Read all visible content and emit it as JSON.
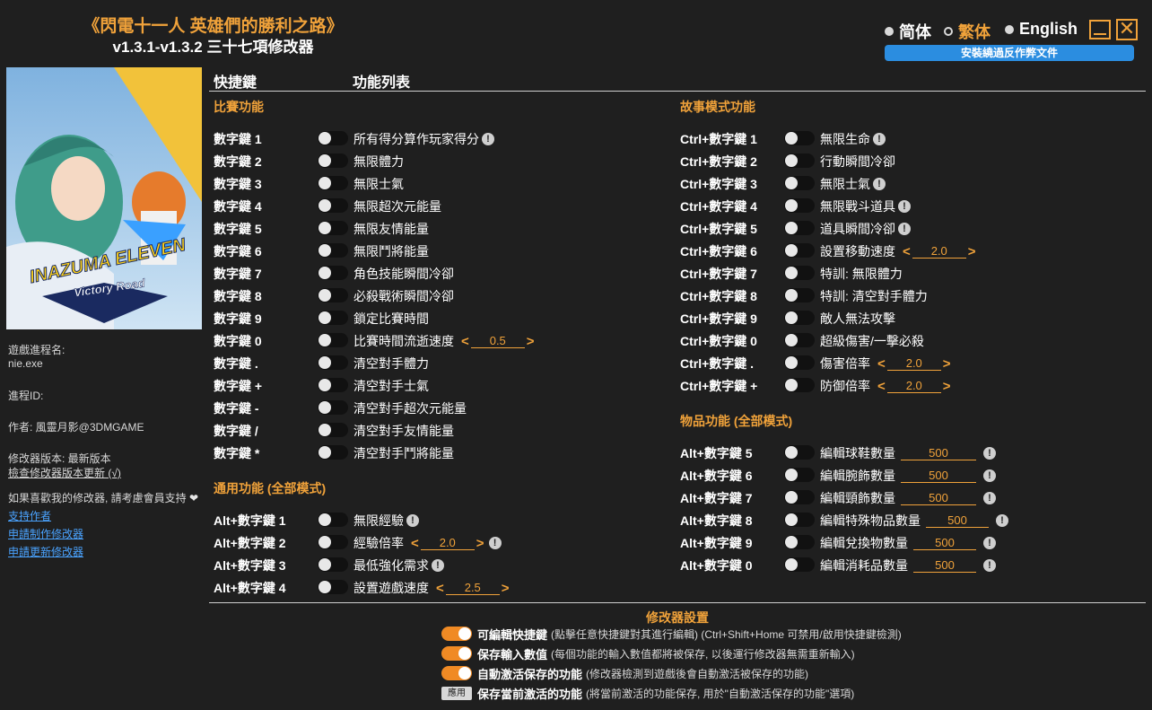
{
  "app": {
    "title_line1": "《閃電十一人 英雄們的勝利之路》",
    "title_line2": "v1.3.1-v1.3.2 三十七項修改器"
  },
  "languages": [
    {
      "label": "简体",
      "active": false
    },
    {
      "label": "繁体",
      "active": true
    },
    {
      "label": "English",
      "active": false
    }
  ],
  "window": {
    "close_glyph": "✕"
  },
  "install_button": "安裝繞過反作弊文件",
  "cover": {
    "logo_text": "INAZUMA ELEVEN",
    "logo_sub": "Victory Road"
  },
  "info": {
    "process_name_label": "遊戲進程名:",
    "process_name": "nie.exe",
    "process_id_label": "進程ID:",
    "author": "作者: 風靈月影@3DMGAME",
    "version": "修改器版本: 最新版本",
    "check_update": "檢查修改器版本更新 (√)",
    "support_text": "如果喜歡我的修改器, 請考慮會員支持",
    "links": [
      "支持作者",
      "申請制作修改器",
      "申請更新修改器"
    ]
  },
  "header": {
    "hotkey": "快捷鍵",
    "list": "功能列表"
  },
  "sections": {
    "match": "比賽功能",
    "general": "通用功能 (全部模式)",
    "story": "故事模式功能",
    "items": "物品功能 (全部模式)"
  },
  "match_rows": [
    {
      "key": "數字鍵 1",
      "name": "所有得分算作玩家得分",
      "warn": true
    },
    {
      "key": "數字鍵 2",
      "name": "無限體力"
    },
    {
      "key": "數字鍵 3",
      "name": "無限士氣"
    },
    {
      "key": "數字鍵 4",
      "name": "無限超次元能量"
    },
    {
      "key": "數字鍵 5",
      "name": "無限友情能量"
    },
    {
      "key": "數字鍵 6",
      "name": "無限鬥將能量"
    },
    {
      "key": "數字鍵 7",
      "name": "角色技能瞬間冷卻"
    },
    {
      "key": "數字鍵 8",
      "name": "必殺戰術瞬間冷卻"
    },
    {
      "key": "數字鍵 9",
      "name": "鎖定比賽時間"
    },
    {
      "key": "數字鍵 0",
      "name": "比賽時間流逝速度",
      "value": "0.5"
    },
    {
      "key": "數字鍵 .",
      "name": "清空對手體力"
    },
    {
      "key": "數字鍵 +",
      "name": "清空對手士氣"
    },
    {
      "key": "數字鍵 -",
      "name": "清空對手超次元能量"
    },
    {
      "key": "數字鍵 /",
      "name": "清空對手友情能量"
    },
    {
      "key": "數字鍵 *",
      "name": "清空對手鬥將能量"
    }
  ],
  "general_rows": [
    {
      "key": "Alt+數字鍵 1",
      "name": "無限經驗",
      "warn": true
    },
    {
      "key": "Alt+數字鍵 2",
      "name": "經驗倍率",
      "value": "2.0",
      "warn": true
    },
    {
      "key": "Alt+數字鍵 3",
      "name": "最低強化需求",
      "warn": true
    },
    {
      "key": "Alt+數字鍵 4",
      "name": "設置遊戲速度",
      "value": "2.5"
    }
  ],
  "story_rows": [
    {
      "key": "Ctrl+數字鍵 1",
      "name": "無限生命",
      "warn": true
    },
    {
      "key": "Ctrl+數字鍵 2",
      "name": "行動瞬間冷卻"
    },
    {
      "key": "Ctrl+數字鍵 3",
      "name": "無限士氣",
      "warn": true
    },
    {
      "key": "Ctrl+數字鍵 4",
      "name": "無限戰斗道具",
      "warn": true
    },
    {
      "key": "Ctrl+數字鍵 5",
      "name": "道具瞬間冷卻",
      "warn": true
    },
    {
      "key": "Ctrl+數字鍵 6",
      "name": "設置移動速度",
      "value": "2.0"
    },
    {
      "key": "Ctrl+數字鍵 7",
      "name": "特訓: 無限體力"
    },
    {
      "key": "Ctrl+數字鍵 8",
      "name": "特訓: 清空對手體力"
    },
    {
      "key": "Ctrl+數字鍵 9",
      "name": "敵人無法攻擊"
    },
    {
      "key": "Ctrl+數字鍵 0",
      "name": "超級傷害/一擊必殺"
    },
    {
      "key": "Ctrl+數字鍵 .",
      "name": "傷害倍率",
      "value": "2.0"
    },
    {
      "key": "Ctrl+數字鍵 +",
      "name": "防御倍率",
      "value": "2.0"
    }
  ],
  "item_rows": [
    {
      "key": "Alt+數字鍵 5",
      "name": "編輯球鞋數量",
      "edit": "500"
    },
    {
      "key": "Alt+數字鍵 6",
      "name": "編輯腕飾數量",
      "edit": "500"
    },
    {
      "key": "Alt+數字鍵 7",
      "name": "編輯頸飾數量",
      "edit": "500"
    },
    {
      "key": "Alt+數字鍵 8",
      "name": "編輯特殊物品數量",
      "edit": "500"
    },
    {
      "key": "Alt+數字鍵 9",
      "name": "編輯兌換物數量",
      "edit": "500"
    },
    {
      "key": "Alt+數字鍵 0",
      "name": "編輯消耗品數量",
      "edit": "500"
    }
  ],
  "settings": {
    "title": "修改器設置",
    "rows": [
      {
        "type": "toggle",
        "label": "可編輯快捷鍵",
        "desc": "(點擊任意快捷鍵對其進行編輯) (Ctrl+Shift+Home 可禁用/啟用快捷鍵檢測)"
      },
      {
        "type": "toggle",
        "label": "保存輸入數值",
        "desc": "(每個功能的輸入數值都將被保存, 以後運行修改器無需重新輸入)"
      },
      {
        "type": "toggle",
        "label": "自動激活保存的功能",
        "desc": "(修改器檢測到遊戲後會自動激活被保存的功能)"
      },
      {
        "type": "button",
        "button": "應用",
        "label": "保存當前激活的功能",
        "desc": "(將當前激活的功能保存, 用於\"自動激活保存的功能\"選項)"
      }
    ]
  },
  "colors": {
    "accent": "#f0a23a",
    "link": "#4aa3ff",
    "bg": "#1f1f1f",
    "install": "#2b8de0"
  }
}
